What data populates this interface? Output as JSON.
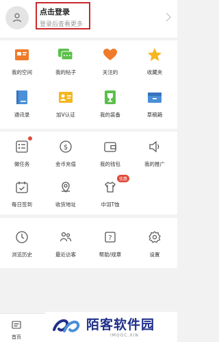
{
  "profile": {
    "title": "点击登录",
    "subtitle": "登录后查看更多"
  },
  "section1": [
    {
      "label": "我的空间",
      "icon": "id-card-icon"
    },
    {
      "label": "我的帖子",
      "icon": "chat-bubble-icon"
    },
    {
      "label": "关注的",
      "icon": "heart-icon"
    },
    {
      "label": "收藏夹",
      "icon": "star-icon"
    },
    {
      "label": "通讯录",
      "icon": "address-book-icon"
    },
    {
      "label": "加V认证",
      "icon": "verify-card-icon"
    },
    {
      "label": "我的装备",
      "icon": "trophy-icon"
    },
    {
      "label": "草稿箱",
      "icon": "drafts-icon"
    }
  ],
  "section2": [
    {
      "label": "做任务",
      "icon": "task-list-icon"
    },
    {
      "label": "金币充值",
      "icon": "coin-icon"
    },
    {
      "label": "我的钱包",
      "icon": "wallet-icon"
    },
    {
      "label": "我的推广",
      "icon": "speaker-icon"
    },
    {
      "label": "每日签到",
      "icon": "calendar-check-icon"
    },
    {
      "label": "收货地址",
      "icon": "location-icon"
    },
    {
      "label": "中羽T恤",
      "icon": "tshirt-icon",
      "badge": "优惠"
    }
  ],
  "section3": [
    {
      "label": "浏览历史",
      "icon": "clock-icon"
    },
    {
      "label": "最近访客",
      "icon": "visitors-icon"
    },
    {
      "label": "帮助/规章",
      "icon": "help-icon"
    },
    {
      "label": "设置",
      "icon": "gear-icon"
    }
  ],
  "tabbar": {
    "home": "首页"
  },
  "watermark": {
    "name": "陌客软件园",
    "domain": "IMOOC.XIN"
  },
  "colors": {
    "accent_orange": "#f07a2a",
    "accent_green": "#5cc04a",
    "accent_blue": "#4a8fd8",
    "accent_yellow": "#f5b720",
    "login_border": "#c9272b",
    "line_icon": "#555555",
    "badge_red": "#e04a3a"
  }
}
